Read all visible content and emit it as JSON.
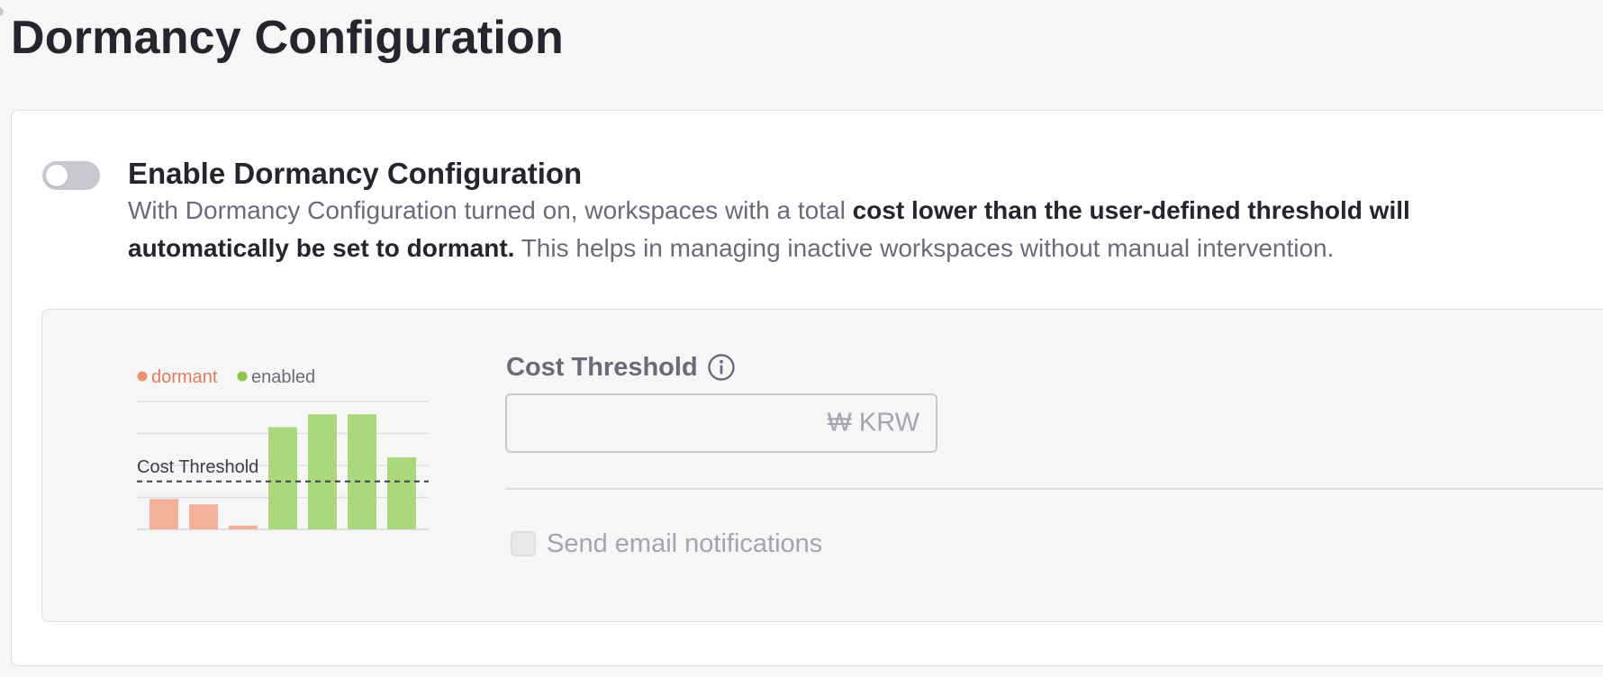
{
  "page": {
    "title": "Dormancy Configuration"
  },
  "toggle": {
    "enabled": false,
    "title": "Enable Dormancy Configuration",
    "description_part1": "With Dormancy Configuration turned on, workspaces with a total ",
    "description_bold": "cost lower than the user-defined threshold will automatically be set to dormant.",
    "description_part2": " This helps in managing inactive workspaces without manual intervention."
  },
  "cost_threshold": {
    "label": "Cost Threshold",
    "value": "",
    "placeholder": "",
    "currency_suffix": "₩ KRW",
    "icon": "info-icon"
  },
  "email_notifications": {
    "label": "Send email notifications",
    "checked": false
  },
  "colors": {
    "dormant": "#f4b199",
    "dormant_text": "#e07b5a",
    "dormant_dot": "#ee9070",
    "enabled": "#a9d97a",
    "enabled_dot": "#8bc54a"
  },
  "chart_data": {
    "type": "bar",
    "legend": [
      "dormant",
      "enabled"
    ],
    "legend_position": "top-left",
    "threshold_label": "Cost Threshold",
    "threshold": 1.5,
    "ylim": [
      0,
      4
    ],
    "grid": true,
    "values": [
      0.95,
      0.78,
      0.12,
      3.2,
      3.6,
      3.6,
      2.25
    ],
    "statuses": [
      "dormant",
      "dormant",
      "dormant",
      "enabled",
      "enabled",
      "enabled",
      "enabled"
    ]
  }
}
